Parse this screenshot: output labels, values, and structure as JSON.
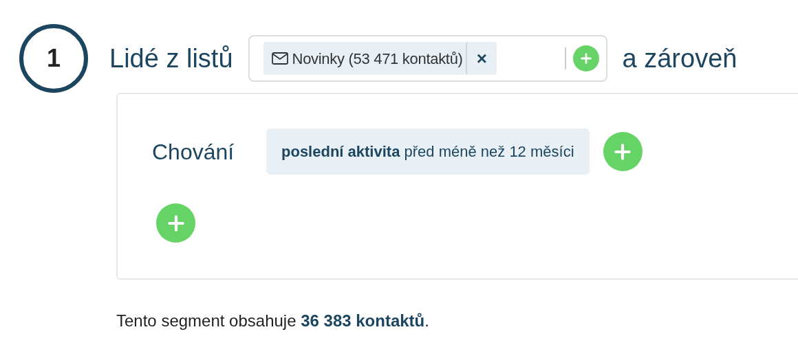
{
  "step": {
    "number": "1",
    "title": "Lidé z listů",
    "lists": [
      {
        "label": "Novinky (53 471 kontaktů)",
        "remove": "×"
      }
    ],
    "conjunction": "a zároveň"
  },
  "conditions": [
    {
      "category": "Chování",
      "rules": [
        "**poslední aktivita** před méně než 12 měsíci"
      ]
    }
  ],
  "summary": "Tento segment obsahuje **36 383 kontaktů**."
}
